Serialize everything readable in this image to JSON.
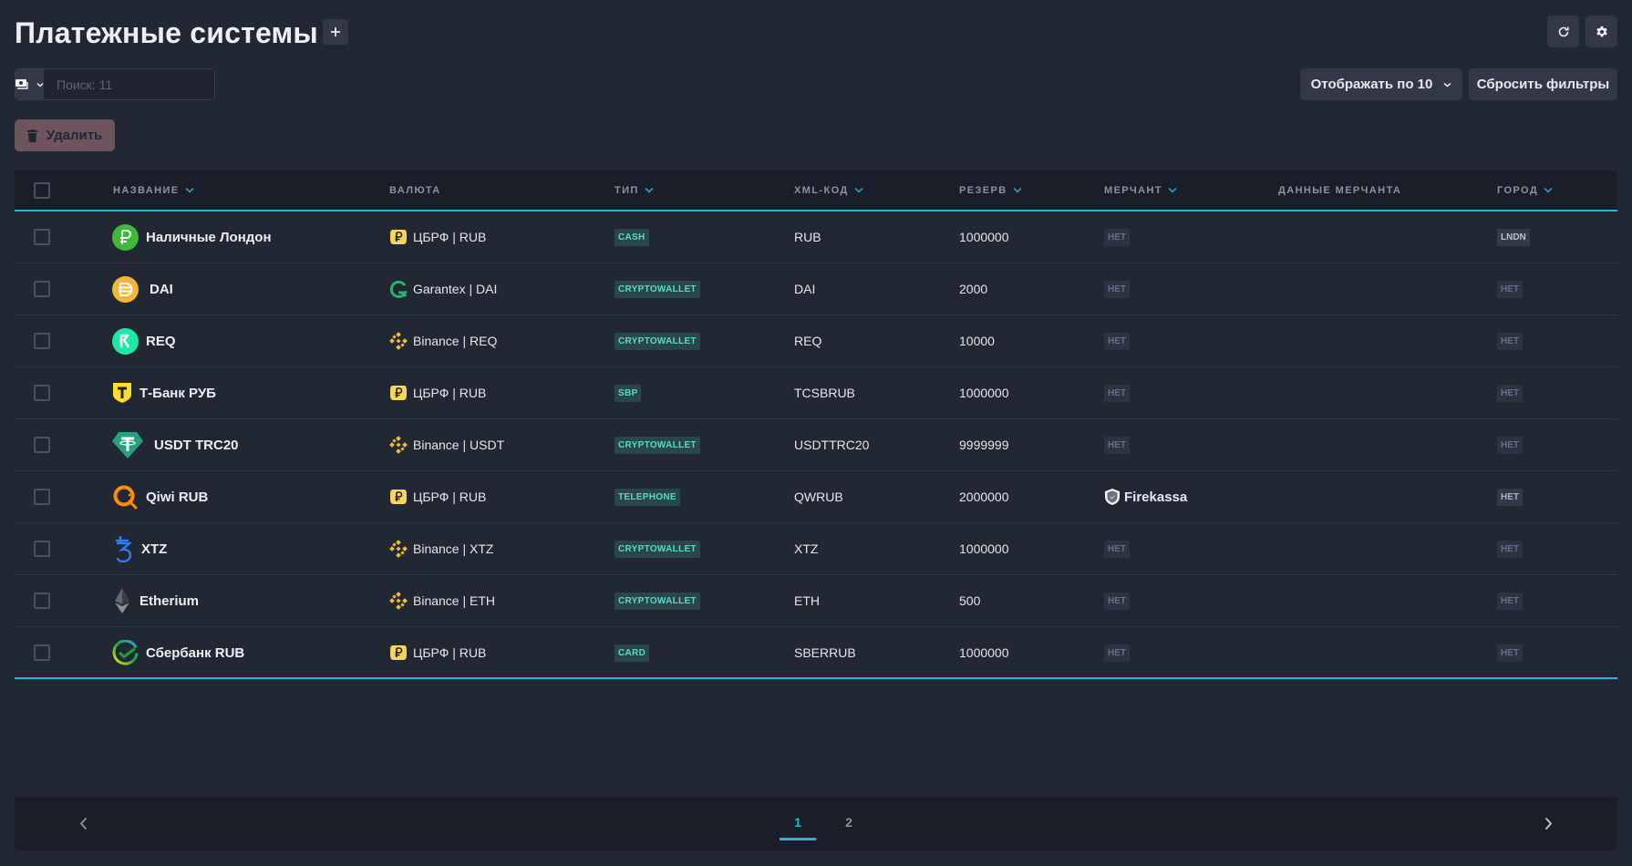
{
  "header": {
    "title": "Платежные системы",
    "add_icon": "plus-icon",
    "refresh_icon": "refresh-icon",
    "settings_icon": "gear-icon"
  },
  "toolbar": {
    "filter_type_icon": "money-icon",
    "search_placeholder": "Поиск: 11",
    "search_value": "",
    "per_page_label": "Отображать по 10",
    "reset_filters_label": "Сбросить фильтры",
    "delete_label": "Удалить"
  },
  "table": {
    "columns": {
      "name": "НАЗВАНИЕ",
      "currency": "ВАЛЮТА",
      "type": "ТИП",
      "xml": "XML-КОД",
      "reserve": "РЕЗЕРВ",
      "merchant": "МЕРЧАНТ",
      "merchant_data": "ДАННЫЕ МЕРЧАНТА",
      "city": "ГОРОД"
    },
    "rows": [
      {
        "name": "Наличные Лондон",
        "icon": "ruble-green-icon",
        "currency": "ЦБРФ | RUB",
        "currency_icon": "ruble-yellow-icon",
        "type": "CASH",
        "xml": "RUB",
        "reserve": "1000000",
        "merchant": "НЕТ",
        "merchant_data": "",
        "city": "LNDN"
      },
      {
        "name": "DAI",
        "icon": "dai-icon",
        "currency": "Garantex | DAI",
        "currency_icon": "garantex-icon",
        "type": "CRYPTOWALLET",
        "xml": "DAI",
        "reserve": "2000",
        "merchant": "НЕТ",
        "merchant_data": "",
        "city": "НЕТ"
      },
      {
        "name": "REQ",
        "icon": "req-icon",
        "currency": "Binance | REQ",
        "currency_icon": "binance-icon",
        "type": "CRYPTOWALLET",
        "xml": "REQ",
        "reserve": "10000",
        "merchant": "НЕТ",
        "merchant_data": "",
        "city": "НЕТ"
      },
      {
        "name": "Т-Банк РУБ",
        "icon": "tbank-icon",
        "currency": "ЦБРФ | RUB",
        "currency_icon": "ruble-yellow-icon",
        "type": "SBP",
        "xml": "TCSBRUB",
        "reserve": "1000000",
        "merchant": "НЕТ",
        "merchant_data": "",
        "city": "НЕТ"
      },
      {
        "name": "USDT TRC20",
        "icon": "tether-icon",
        "currency": "Binance | USDT",
        "currency_icon": "binance-icon",
        "type": "CRYPTOWALLET",
        "xml": "USDTTRC20",
        "reserve": "9999999",
        "merchant": "НЕТ",
        "merchant_data": "",
        "city": "НЕТ"
      },
      {
        "name": "Qiwi RUB",
        "icon": "qiwi-icon",
        "currency": "ЦБРФ | RUB",
        "currency_icon": "ruble-yellow-icon",
        "type": "TELEPHONE",
        "xml": "QWRUB",
        "reserve": "2000000",
        "merchant": "Firekassa",
        "merchant_data": "",
        "city": "НЕТ"
      },
      {
        "name": "XTZ",
        "icon": "tezos-icon",
        "currency": "Binance | XTZ",
        "currency_icon": "binance-icon",
        "type": "CRYPTOWALLET",
        "xml": "XTZ",
        "reserve": "1000000",
        "merchant": "НЕТ",
        "merchant_data": "",
        "city": "НЕТ"
      },
      {
        "name": "Etherium",
        "icon": "ethereum-icon",
        "currency": "Binance | ETH",
        "currency_icon": "binance-icon",
        "type": "CRYPTOWALLET",
        "xml": "ETH",
        "reserve": "500",
        "merchant": "НЕТ",
        "merchant_data": "",
        "city": "НЕТ"
      },
      {
        "name": "Сбербанк RUB",
        "icon": "sberbank-icon",
        "currency": "ЦБРФ | RUB",
        "currency_icon": "ruble-yellow-icon",
        "type": "CARD",
        "xml": "SBERRUB",
        "reserve": "1000000",
        "merchant": "НЕТ",
        "merchant_data": "",
        "city": "НЕТ"
      }
    ]
  },
  "pagination": {
    "pages": [
      "1",
      "2"
    ],
    "current": "1"
  },
  "colors": {
    "accent": "#22b8d8",
    "background": "#212733",
    "header_bg": "#1a1e28",
    "badge_type_text": "#5dd7c4",
    "delete_bg": "#6e545d"
  }
}
